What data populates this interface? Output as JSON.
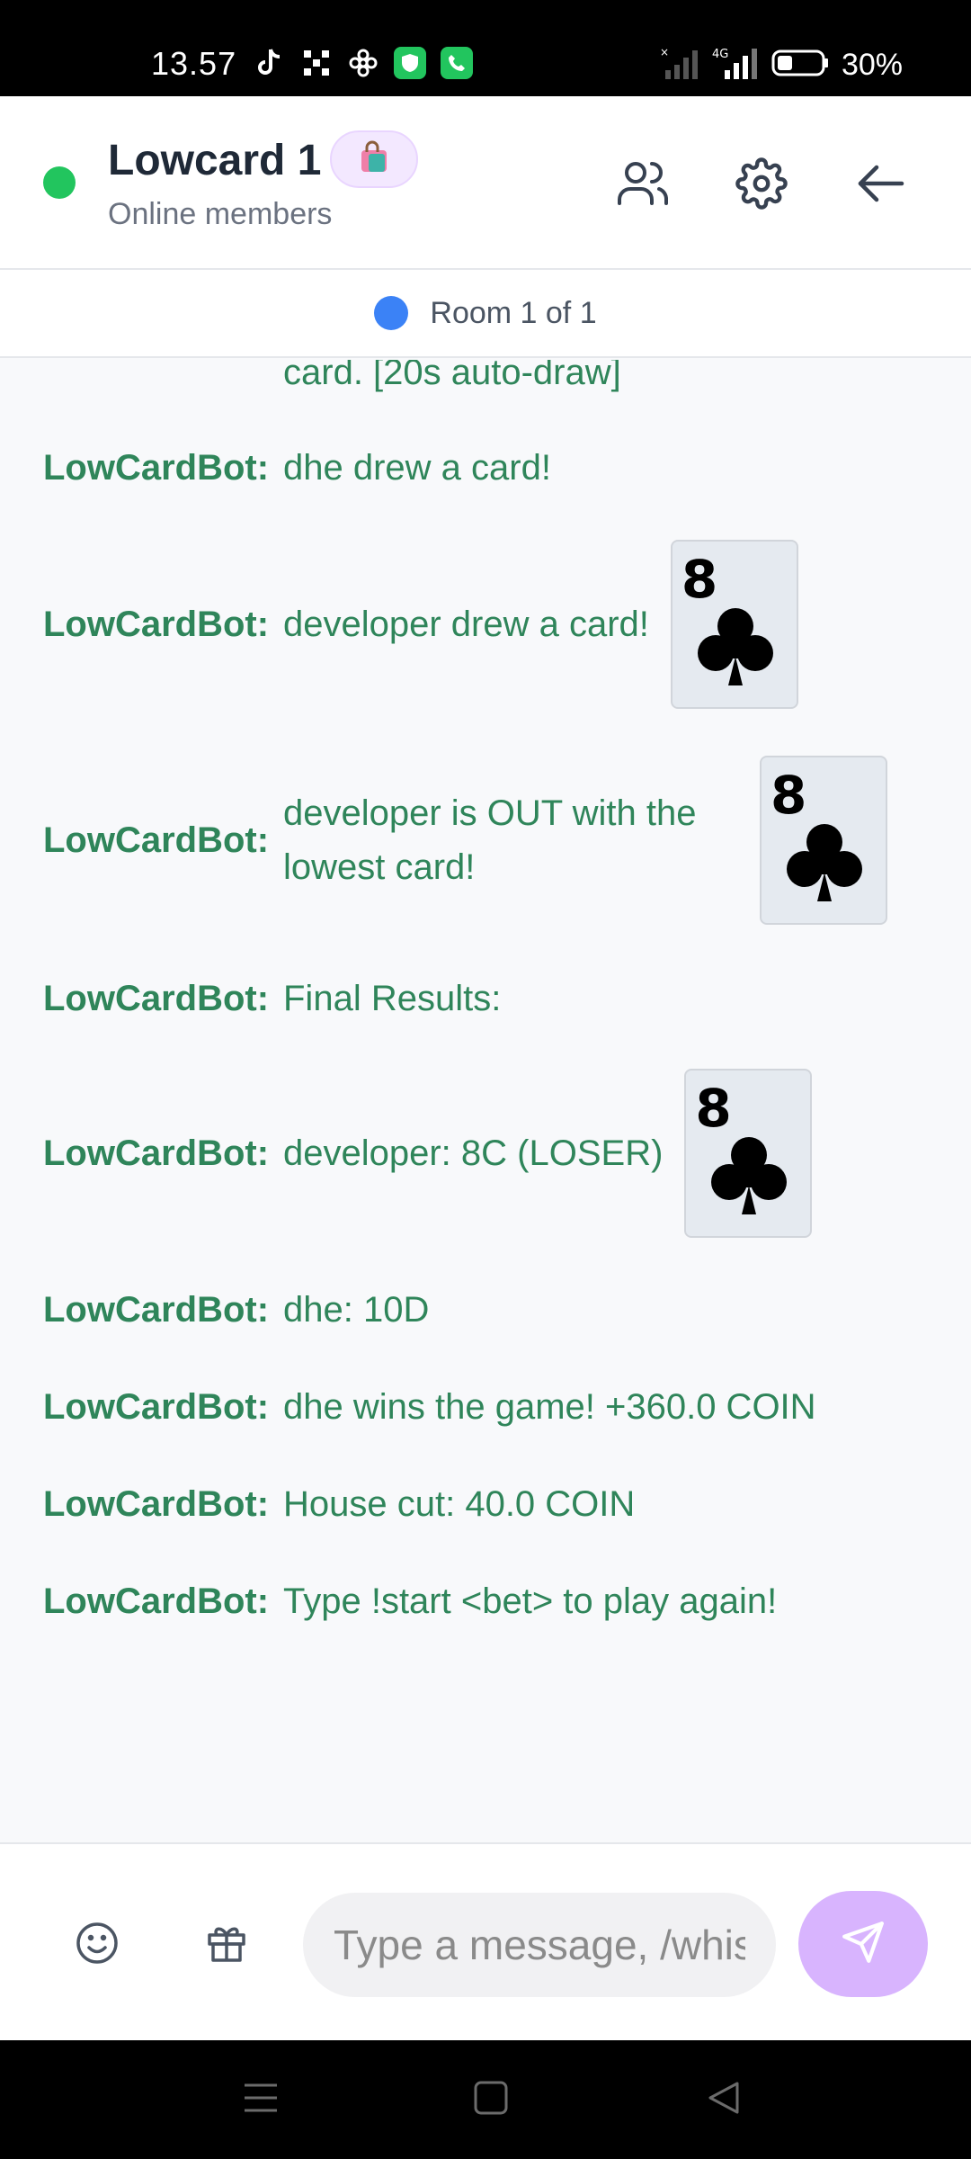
{
  "status_bar": {
    "time": "13.57",
    "battery": "30%",
    "network": "4G"
  },
  "header": {
    "title": "Lowcard 1",
    "subtitle": "Online members",
    "badge_icon": "shopping-bag-icon",
    "accent_online": "#22c55e"
  },
  "room_indicator": {
    "label": "Room 1 of 1",
    "dot_color": "#3b82f6"
  },
  "messages": [
    {
      "sender": "",
      "text": "card. [20s auto-draw]"
    },
    {
      "sender": "LowCardBot:",
      "text": "dhe drew a card!"
    },
    {
      "sender": "LowCardBot:",
      "text": "developer drew a card!",
      "card": {
        "rank": "8",
        "suit": "clubs"
      }
    },
    {
      "sender": "LowCardBot:",
      "text": "developer is OUT with the lowest card!",
      "card": {
        "rank": "8",
        "suit": "clubs"
      }
    },
    {
      "sender": "LowCardBot:",
      "text": "Final Results:"
    },
    {
      "sender": "LowCardBot:",
      "text": "developer: 8C (LOSER)",
      "card": {
        "rank": "8",
        "suit": "clubs"
      }
    },
    {
      "sender": "LowCardBot:",
      "text": "dhe: 10D"
    },
    {
      "sender": "LowCardBot:",
      "text": "dhe wins the game! +360.0 COIN"
    },
    {
      "sender": "LowCardBot:",
      "text": "House cut: 40.0 COIN"
    },
    {
      "sender": "LowCardBot:",
      "text": "Type !start <bet> to play again!"
    }
  ],
  "composer": {
    "placeholder": "Type a message, /whisper...",
    "send_color": "#d8b4fe"
  },
  "colors": {
    "bot_text": "#2f855a",
    "background": "#f8f9fb"
  }
}
